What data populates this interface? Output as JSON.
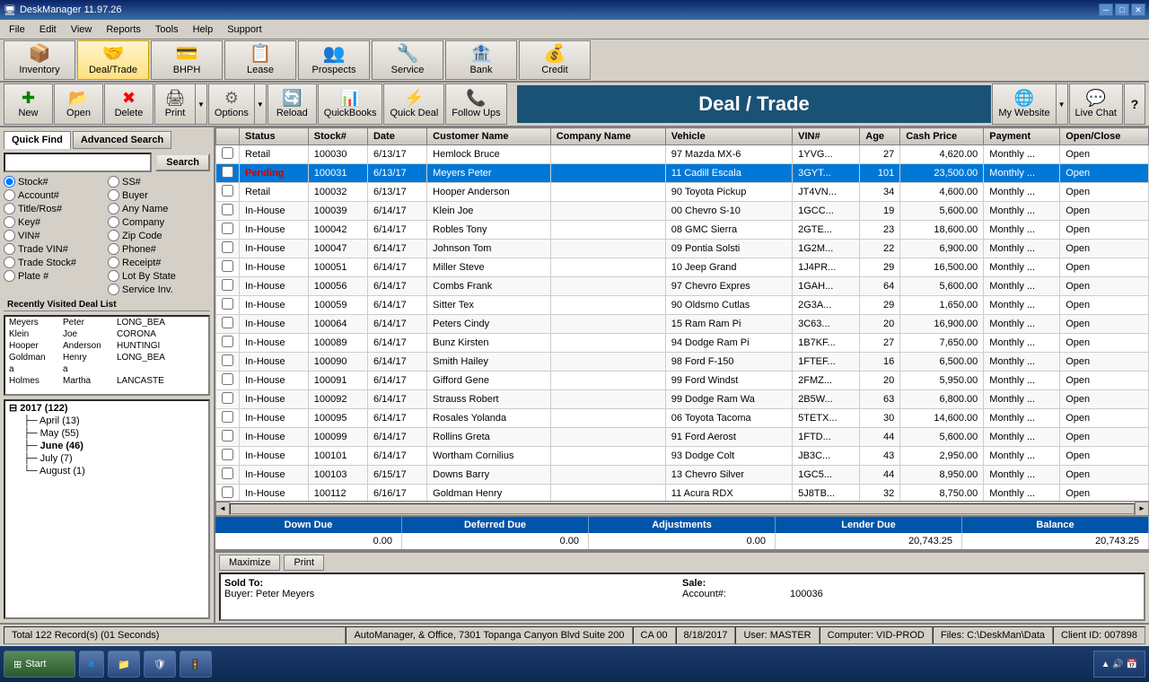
{
  "titlebar": {
    "title": "DeskManager 11.97.26",
    "icon": "🖥",
    "min_label": "─",
    "max_label": "□",
    "close_label": "✕"
  },
  "menubar": {
    "items": [
      "File",
      "Edit",
      "View",
      "Reports",
      "Tools",
      "Help",
      "Support"
    ]
  },
  "navbar": {
    "items": [
      {
        "label": "Inventory",
        "icon": "📦",
        "active": false
      },
      {
        "label": "Deal/Trade",
        "icon": "🤝",
        "active": true
      },
      {
        "label": "BHPH",
        "icon": "💳",
        "active": false
      },
      {
        "label": "Lease",
        "icon": "📋",
        "active": false
      },
      {
        "label": "Prospects",
        "icon": "👥",
        "active": false
      },
      {
        "label": "Service",
        "icon": "🔧",
        "active": false
      },
      {
        "label": "Bank",
        "icon": "🏦",
        "active": false
      },
      {
        "label": "Credit",
        "icon": "💰",
        "active": false
      }
    ]
  },
  "toolbar": {
    "buttons": [
      {
        "label": "New",
        "icon": "✚",
        "color": "green"
      },
      {
        "label": "Open",
        "icon": "📂",
        "color": "yellow"
      },
      {
        "label": "Delete",
        "icon": "✖",
        "color": "red"
      },
      {
        "label": "Print",
        "icon": "🖨",
        "color": "blue",
        "has_arrow": true
      },
      {
        "label": "Options",
        "icon": "⚙",
        "color": "gray",
        "has_arrow": true
      },
      {
        "label": "Reload",
        "icon": "🔄",
        "color": "blue"
      },
      {
        "label": "QuickBooks",
        "icon": "📊",
        "color": "green"
      },
      {
        "label": "Quick Deal",
        "icon": "⚡",
        "color": "yellow"
      },
      {
        "label": "Follow Ups",
        "icon": "📞",
        "color": "orange"
      }
    ],
    "title": "Deal / Trade",
    "website_label": "My Website",
    "livechat_label": "Live Chat",
    "help_label": "?"
  },
  "quickfind": {
    "tab_active": "Quick Find",
    "tab_advanced": "Advanced Search",
    "search_placeholder": "",
    "search_btn": "Search",
    "radio_groups": [
      [
        {
          "label": "Stock#",
          "value": "stock"
        },
        {
          "label": "SS#",
          "value": "ss"
        }
      ],
      [
        {
          "label": "Account#",
          "value": "account"
        },
        {
          "label": "Buyer",
          "value": "buyer"
        }
      ],
      [
        {
          "label": "Title/Ros#",
          "value": "title"
        },
        {
          "label": "Any Name",
          "value": "anyname"
        }
      ],
      [
        {
          "label": "Key#",
          "value": "key"
        },
        {
          "label": "Company",
          "value": "company"
        }
      ],
      [
        {
          "label": "VIN#",
          "value": "vin"
        },
        {
          "label": "Zip Code",
          "value": "zip"
        }
      ],
      [
        {
          "label": "Trade VIN#",
          "value": "tradevin"
        },
        {
          "label": "Phone#",
          "value": "phone"
        }
      ],
      [
        {
          "label": "Trade Stock#",
          "value": "tradestock"
        },
        {
          "label": "Receipt#",
          "value": "receipt"
        }
      ],
      [
        {
          "label": "Plate #",
          "value": "plate"
        },
        {
          "label": "Lot By State",
          "value": "lotbystate"
        }
      ],
      [
        {
          "label": "",
          "value": ""
        },
        {
          "label": "Service Inv.",
          "value": "serviceinv"
        }
      ]
    ]
  },
  "recent_list": {
    "header": "Recently Visited Deal List",
    "items": [
      {
        "col1": "Meyers",
        "col2": "Peter",
        "col3": "LONG_BEA"
      },
      {
        "col1": "Klein",
        "col2": "Joe",
        "col3": "CORONA"
      },
      {
        "col1": "Hooper",
        "col2": "Anderson",
        "col3": "HUNTINGI"
      },
      {
        "col1": "Goldman",
        "col2": "Henry",
        "col3": "LONG_BEA"
      },
      {
        "col1": "a",
        "col2": "a",
        "col3": ""
      },
      {
        "col1": "Holmes",
        "col2": "Martha",
        "col3": "LANCASTE"
      }
    ]
  },
  "tree": {
    "items": [
      {
        "label": "2017 (122)",
        "level": "parent",
        "expanded": true
      },
      {
        "label": "April (13)",
        "level": "child"
      },
      {
        "label": "May (55)",
        "level": "child"
      },
      {
        "label": "June (46)",
        "level": "child",
        "expanded": true
      },
      {
        "label": "July (7)",
        "level": "child"
      },
      {
        "label": "August (1)",
        "level": "child"
      }
    ]
  },
  "table": {
    "columns": [
      "",
      "Status",
      "Stock#",
      "Date",
      "Customer Name",
      "Company Name",
      "Vehicle",
      "VIN#",
      "Age",
      "Cash Price",
      "Payment",
      "Open/Close"
    ],
    "rows": [
      {
        "status": "Retail",
        "stock": "100030",
        "date": "6/13/17",
        "customer": "Hemlock Bruce",
        "company": "",
        "vehicle": "97 Mazda MX-6",
        "vin": "1YVG...",
        "age": "27",
        "cash_price": "4,620.00",
        "payment": "Monthly ...",
        "open_close": "Open"
      },
      {
        "status": "Pending",
        "stock": "100031",
        "date": "6/13/17",
        "customer": "Meyers Peter",
        "company": "",
        "vehicle": "11 Cadill Escala",
        "vin": "3GYT...",
        "age": "101",
        "cash_price": "23,500.00",
        "payment": "Monthly ...",
        "open_close": "Open",
        "selected": true
      },
      {
        "status": "Retail",
        "stock": "100032",
        "date": "6/13/17",
        "customer": "Hooper Anderson",
        "company": "",
        "vehicle": "90 Toyota Pickup",
        "vin": "JT4VN...",
        "age": "34",
        "cash_price": "4,600.00",
        "payment": "Monthly ...",
        "open_close": "Open"
      },
      {
        "status": "In-House",
        "stock": "100039",
        "date": "6/14/17",
        "customer": "Klein Joe",
        "company": "",
        "vehicle": "00 Chevro S-10",
        "vin": "1GCC...",
        "age": "19",
        "cash_price": "5,600.00",
        "payment": "Monthly ...",
        "open_close": "Open"
      },
      {
        "status": "In-House",
        "stock": "100042",
        "date": "6/14/17",
        "customer": "Robles Tony",
        "company": "",
        "vehicle": "08 GMC Sierra",
        "vin": "2GTE...",
        "age": "23",
        "cash_price": "18,600.00",
        "payment": "Monthly ...",
        "open_close": "Open"
      },
      {
        "status": "In-House",
        "stock": "100047",
        "date": "6/14/17",
        "customer": "Johnson Tom",
        "company": "",
        "vehicle": "09 Pontia Solsti",
        "vin": "1G2M...",
        "age": "22",
        "cash_price": "6,900.00",
        "payment": "Monthly ...",
        "open_close": "Open"
      },
      {
        "status": "In-House",
        "stock": "100051",
        "date": "6/14/17",
        "customer": "Miller Steve",
        "company": "",
        "vehicle": "10 Jeep Grand",
        "vin": "1J4PR...",
        "age": "29",
        "cash_price": "16,500.00",
        "payment": "Monthly ...",
        "open_close": "Open"
      },
      {
        "status": "In-House",
        "stock": "100056",
        "date": "6/14/17",
        "customer": "Combs Frank",
        "company": "",
        "vehicle": "97 Chevro Expres",
        "vin": "1GAH...",
        "age": "64",
        "cash_price": "5,600.00",
        "payment": "Monthly ...",
        "open_close": "Open"
      },
      {
        "status": "In-House",
        "stock": "100059",
        "date": "6/14/17",
        "customer": "Sitter Tex",
        "company": "",
        "vehicle": "90 Oldsmo Cutlas",
        "vin": "2G3A...",
        "age": "29",
        "cash_price": "1,650.00",
        "payment": "Monthly ...",
        "open_close": "Open"
      },
      {
        "status": "In-House",
        "stock": "100064",
        "date": "6/14/17",
        "customer": "Peters Cindy",
        "company": "",
        "vehicle": "15 Ram Ram Pi",
        "vin": "3C63...",
        "age": "20",
        "cash_price": "16,900.00",
        "payment": "Monthly ...",
        "open_close": "Open"
      },
      {
        "status": "In-House",
        "stock": "100089",
        "date": "6/14/17",
        "customer": "Bunz Kirsten",
        "company": "",
        "vehicle": "94 Dodge Ram Pi",
        "vin": "1B7KF...",
        "age": "27",
        "cash_price": "7,650.00",
        "payment": "Monthly ...",
        "open_close": "Open"
      },
      {
        "status": "In-House",
        "stock": "100090",
        "date": "6/14/17",
        "customer": "Smith Hailey",
        "company": "",
        "vehicle": "98 Ford F-150",
        "vin": "1FTEF...",
        "age": "16",
        "cash_price": "6,500.00",
        "payment": "Monthly ...",
        "open_close": "Open"
      },
      {
        "status": "In-House",
        "stock": "100091",
        "date": "6/14/17",
        "customer": "Gifford Gene",
        "company": "",
        "vehicle": "99 Ford Windst",
        "vin": "2FMZ...",
        "age": "20",
        "cash_price": "5,950.00",
        "payment": "Monthly ...",
        "open_close": "Open"
      },
      {
        "status": "In-House",
        "stock": "100092",
        "date": "6/14/17",
        "customer": "Strauss Robert",
        "company": "",
        "vehicle": "99 Dodge Ram Wa",
        "vin": "2B5W...",
        "age": "63",
        "cash_price": "6,800.00",
        "payment": "Monthly ...",
        "open_close": "Open"
      },
      {
        "status": "In-House",
        "stock": "100095",
        "date": "6/14/17",
        "customer": "Rosales Yolanda",
        "company": "",
        "vehicle": "06 Toyota Tacoma",
        "vin": "5TETX...",
        "age": "30",
        "cash_price": "14,600.00",
        "payment": "Monthly ...",
        "open_close": "Open"
      },
      {
        "status": "In-House",
        "stock": "100099",
        "date": "6/14/17",
        "customer": "Rollins Greta",
        "company": "",
        "vehicle": "91 Ford Aerost",
        "vin": "1FTD...",
        "age": "44",
        "cash_price": "5,600.00",
        "payment": "Monthly ...",
        "open_close": "Open"
      },
      {
        "status": "In-House",
        "stock": "100101",
        "date": "6/14/17",
        "customer": "Wortham Cornilius",
        "company": "",
        "vehicle": "93 Dodge Colt",
        "vin": "JB3C...",
        "age": "43",
        "cash_price": "2,950.00",
        "payment": "Monthly ...",
        "open_close": "Open"
      },
      {
        "status": "In-House",
        "stock": "100103",
        "date": "6/15/17",
        "customer": "Downs Barry",
        "company": "",
        "vehicle": "13 Chevro Silver",
        "vin": "1GC5...",
        "age": "44",
        "cash_price": "8,950.00",
        "payment": "Monthly ...",
        "open_close": "Open"
      },
      {
        "status": "In-House",
        "stock": "100112",
        "date": "6/16/17",
        "customer": "Goldman Henry",
        "company": "",
        "vehicle": "11 Acura RDX",
        "vin": "5J8TB...",
        "age": "32",
        "cash_price": "8,750.00",
        "payment": "Monthly ...",
        "open_close": "Open"
      }
    ]
  },
  "totals": {
    "labels": [
      "Down Due",
      "Deferred Due",
      "Adjustments",
      "Lender Due",
      "Balance"
    ],
    "values": [
      "0.00",
      "0.00",
      "0.00",
      "20,743.25",
      "20,743.25"
    ]
  },
  "detail": {
    "maximize_label": "Maximize",
    "print_label": "Print",
    "sold_to_label": "Sold To:",
    "buyer_label": "Buyer:",
    "buyer_name": "Peter Meyers",
    "sale_label": "Sale:",
    "account_label": "Account#:",
    "account_value": "100036"
  },
  "statusbar": {
    "main": "Total 122 Record(s) (01 Seconds)",
    "segments": [
      "AutoManager, & Office, 7301 Topanga Canyon Blvd Suite 200",
      "CA 00",
      "8/18/2017",
      "User: MASTER",
      "Computer: VID-PROD",
      "Files: C:\\DeskMan\\Data",
      "Client ID: 007898"
    ]
  },
  "taskbar": {
    "start_label": "Start",
    "apps": [
      {
        "label": "e",
        "title": "Edge"
      },
      {
        "label": "📁",
        "title": "Explorer"
      },
      {
        "label": "🛡",
        "title": "Security"
      },
      {
        "label": "🚦",
        "title": "Lights"
      }
    ],
    "time": "▲ 🔊 📅",
    "datetime": ""
  }
}
